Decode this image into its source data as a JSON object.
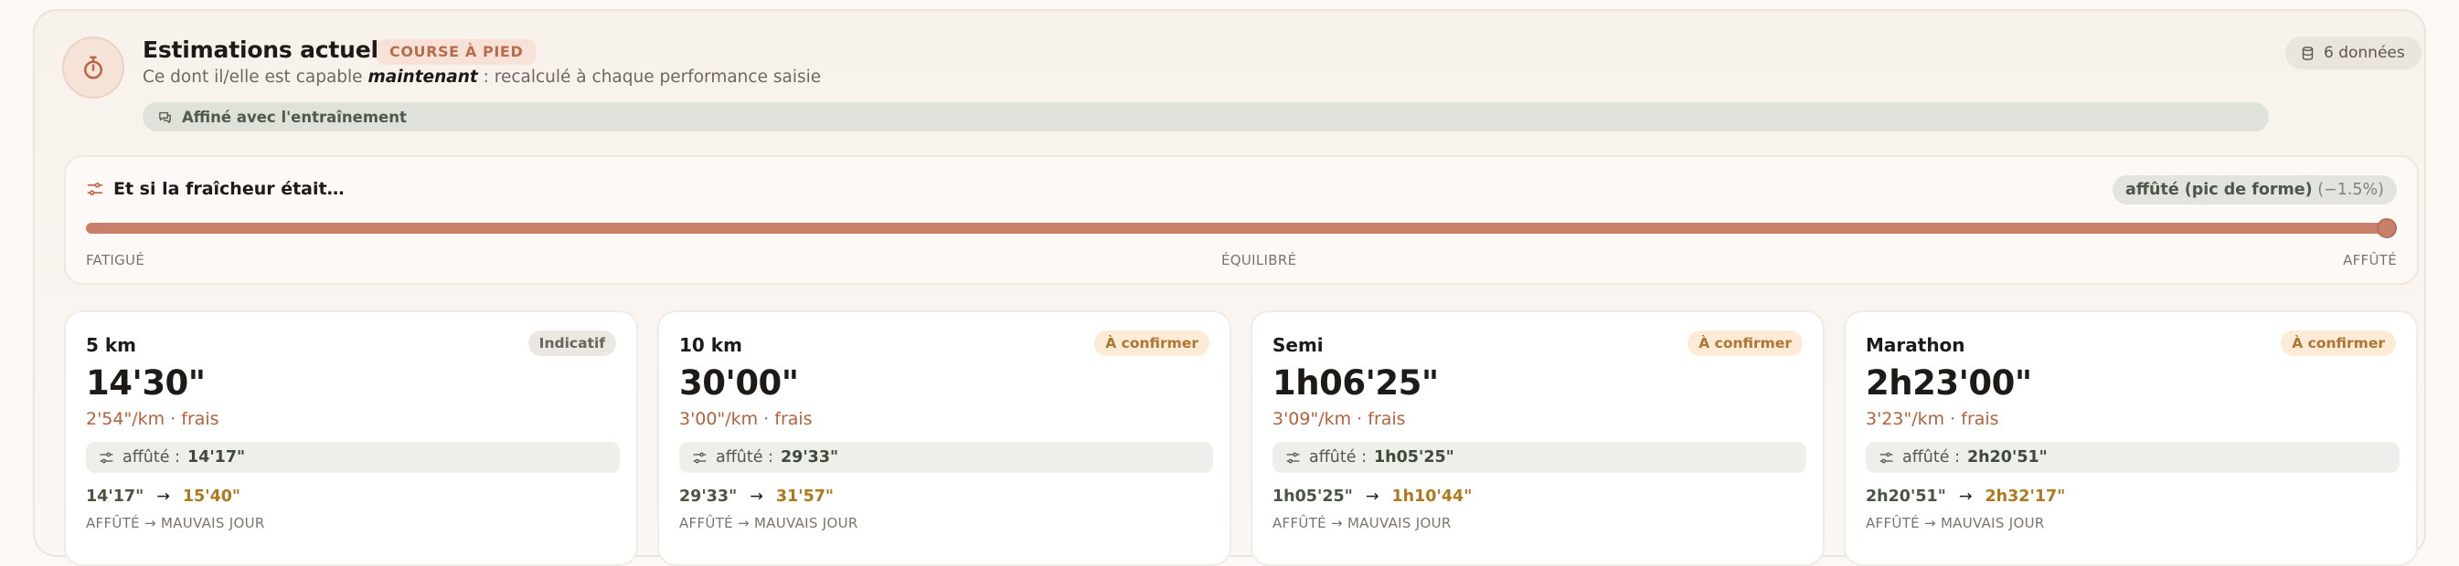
{
  "header": {
    "title": "Estimations actuelles",
    "sport_badge": "COURSE À PIED",
    "subtitle_before": "Ce dont il/elle est capable ",
    "subtitle_emphasis": "maintenant",
    "subtitle_after": " : recalculé à chaque performance saisie",
    "refined_label": "Affiné avec l'entraînement",
    "data_count": "6 données",
    "icon": "stopwatch-icon"
  },
  "freshness": {
    "title": "Et si la fraîcheur était…",
    "state_label": "affûté (pic de forme)",
    "state_pct": "(−1.5%)",
    "slider_value": 1.0,
    "scale_left": "FATIGUÉ",
    "scale_mid": "ÉQUILIBRÉ",
    "scale_right": "AFFÛTÉ"
  },
  "cards": [
    {
      "distance": "5 km",
      "tag": "Indicatif",
      "tag_kind": "neutral",
      "time": "14'30\"",
      "pace": "2'54\"/km · frais",
      "sharp_label": "affûté :",
      "sharp_value": "14'17\"",
      "range_low": "14'17\"",
      "range_high": "15'40\"",
      "range_label": "AFFÛTÉ → MAUVAIS JOUR"
    },
    {
      "distance": "10 km",
      "tag": "À confirmer",
      "tag_kind": "warn",
      "time": "30'00\"",
      "pace": "3'00\"/km · frais",
      "sharp_label": "affûté :",
      "sharp_value": "29'33\"",
      "range_low": "29'33\"",
      "range_high": "31'57\"",
      "range_label": "AFFÛTÉ → MAUVAIS JOUR"
    },
    {
      "distance": "Semi",
      "tag": "À confirmer",
      "tag_kind": "warn",
      "time": "1h06'25\"",
      "pace": "3'09\"/km · frais",
      "sharp_label": "affûté :",
      "sharp_value": "1h05'25\"",
      "range_low": "1h05'25\"",
      "range_high": "1h10'44\"",
      "range_label": "AFFÛTÉ → MAUVAIS JOUR"
    },
    {
      "distance": "Marathon",
      "tag": "À confirmer",
      "tag_kind": "warn",
      "time": "2h23'00\"",
      "pace": "3'23\"/km · frais",
      "sharp_label": "affûté :",
      "sharp_value": "2h20'51\"",
      "range_low": "2h20'51\"",
      "range_high": "2h32'17\"",
      "range_label": "AFFÛTÉ → MAUVAIS JOUR"
    }
  ],
  "range_arrow": "→",
  "colors": {
    "accent": "#c8806a",
    "warn": "#b0781d",
    "sharp_green": "#4f5a4b"
  }
}
